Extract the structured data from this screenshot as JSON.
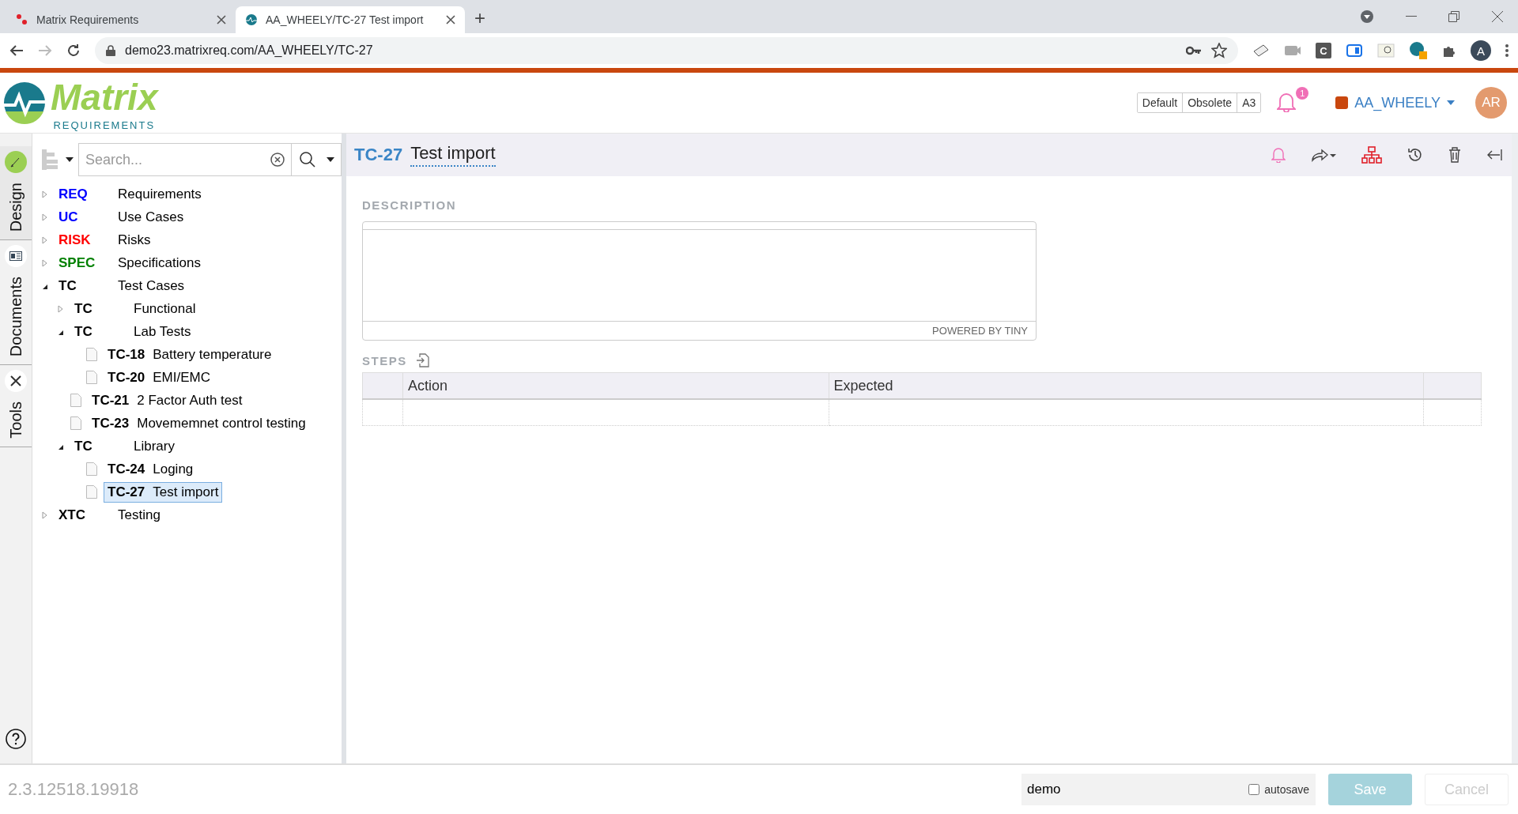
{
  "browser": {
    "tabs": [
      {
        "title": "Matrix Requirements",
        "selected": false
      },
      {
        "title": "AA_WHEELY/TC-27 Test import",
        "selected": true
      }
    ],
    "new_tab": "+",
    "address": "demo23.matrixreq.com/AA_WHEELY/TC-27",
    "extension_letter": "C",
    "profile_initial": "A"
  },
  "header": {
    "logo": {
      "name": "Matrix",
      "tagline": "REQUIREMENTS"
    },
    "filters": [
      {
        "label": "Default"
      },
      {
        "label": "Obsolete"
      },
      {
        "label": "A3"
      }
    ],
    "notification_count": "1",
    "project": {
      "name": "AA_WHEELY",
      "color": "#c9470e"
    },
    "avatar": "AR"
  },
  "rail": [
    {
      "label": "Design",
      "selected": true
    },
    {
      "label": "Documents",
      "selected": false
    },
    {
      "label": "Tools",
      "selected": false
    }
  ],
  "search": {
    "placeholder": "Search..."
  },
  "tree": [
    {
      "kind": "folder",
      "code": "REQ",
      "label": "Requirements",
      "color": "#0000ff",
      "expanded": false,
      "selected": false
    },
    {
      "kind": "folder",
      "code": "UC",
      "label": "Use Cases",
      "color": "#0000ff",
      "expanded": false,
      "selected": false
    },
    {
      "kind": "folder",
      "code": "RISK",
      "label": "Risks",
      "color": "#ff0000",
      "expanded": false,
      "selected": false
    },
    {
      "kind": "folder",
      "code": "SPEC",
      "label": "Specifications",
      "color": "#008000",
      "expanded": false,
      "selected": false
    },
    {
      "kind": "folder",
      "code": "TC",
      "label": "Test Cases",
      "color": "#000000",
      "expanded": true,
      "selected": false,
      "children": [
        {
          "kind": "folder",
          "code": "TC",
          "label": "Functional",
          "expanded": false,
          "selected": false
        },
        {
          "kind": "folder",
          "code": "TC",
          "label": "Lab Tests",
          "expanded": true,
          "selected": false,
          "children": [
            {
              "kind": "item",
              "code": "TC-18",
              "label": "Battery temperature",
              "selected": false
            },
            {
              "kind": "item",
              "code": "TC-20",
              "label": "EMI/EMC",
              "selected": false
            }
          ]
        },
        {
          "kind": "item",
          "code": "TC-21",
          "label": "2 Factor Auth test",
          "selected": false
        },
        {
          "kind": "item",
          "code": "TC-23",
          "label": "Movememnet control testing",
          "selected": false
        },
        {
          "kind": "folder",
          "code": "TC",
          "label": "Library",
          "expanded": true,
          "selected": false,
          "children": [
            {
              "kind": "item",
              "code": "TC-24",
              "label": "Loging",
              "selected": false
            },
            {
              "kind": "item",
              "code": "TC-27",
              "label": "Test import",
              "selected": true
            }
          ]
        }
      ]
    },
    {
      "kind": "folder",
      "code": "XTC",
      "label": "Testing",
      "color": "#000000",
      "expanded": false,
      "selected": false
    }
  ],
  "item": {
    "id": "TC-27",
    "title": "Test import",
    "description_label": "DESCRIPTION",
    "editor_footer": "POWERED BY TINY",
    "steps_label": "STEPS",
    "steps_columns": [
      "Action",
      "Expected"
    ]
  },
  "footer": {
    "version": "2.3.12518.19918",
    "comment": "demo",
    "autosave": {
      "label": "autosave",
      "checked": false
    },
    "save": {
      "label": "Save",
      "disabled": true
    },
    "cancel": {
      "label": "Cancel",
      "disabled": true
    }
  }
}
